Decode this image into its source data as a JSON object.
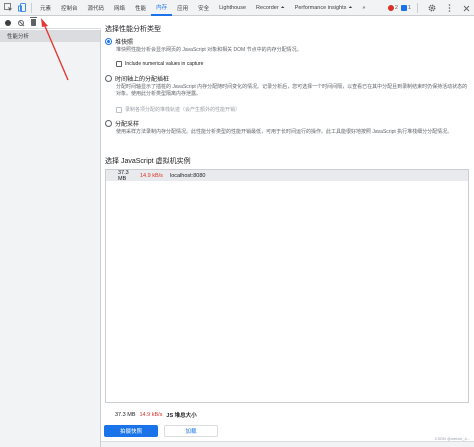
{
  "tabbar": {
    "tabs": [
      {
        "label": "元素"
      },
      {
        "label": "控制台"
      },
      {
        "label": "源代码"
      },
      {
        "label": "网络"
      },
      {
        "label": "性能"
      },
      {
        "label": "内存",
        "active": true
      },
      {
        "label": "应用"
      },
      {
        "label": "安全"
      },
      {
        "label": "Lighthouse"
      },
      {
        "label": "Recorder",
        "suffix": "⏶"
      },
      {
        "label": "Performance insights",
        "suffix": "⏶"
      }
    ],
    "error_count": "2",
    "info_count": "1",
    "more_glyph": "»"
  },
  "sidebar": {
    "items": [
      {
        "label": "性能分析"
      }
    ]
  },
  "main": {
    "profile_type_title": "选择性能分析类型",
    "options": [
      {
        "label": "堆快照",
        "desc": "堆快照性能分析会显示网页的 JavaScript 对象和相关 DOM 节点中的内存分配情况。",
        "checkbox": "Include numerical values in capture",
        "selected": true
      },
      {
        "label": "时间轴上的分配插桩",
        "desc": "分配时间轴显示了插桩的 JavaScript 内存分配随时间变化的情况。记录分析后，您可选择一个时间间隔，以查看已在其中分配且到录制结束时仍保持活动状态的对象。使用此分析类型隔离内存泄露。",
        "checkbox": "录制各项分配的堆栈轨迹（会产生额外的性能开销）",
        "selected": false
      },
      {
        "label": "分配采样",
        "desc": "使用采样方法录制内存分配情况。此性能分析类型的性能开销最低，可用于长时间运行的操作。此工具能很好地按照 JavaScript 执行堆栈细分分配情况。",
        "selected": false
      }
    ],
    "vm_title": "选择 JavaScript 虚拟机实例",
    "vm_instances": [
      {
        "size": "37.3 MB",
        "rate": "14.9 kB/s",
        "target": "localhost:8080"
      }
    ],
    "total": {
      "size": "37.3 MB",
      "rate": "14.9 kB/s",
      "label": "JS 堆总大小"
    },
    "take_snapshot_label": "拍摄快照",
    "load_label": "加载"
  },
  "watermark": "CSDN @weixin_4...",
  "colors": {
    "accent": "#1a73e8",
    "error": "#d93025",
    "annotation": "#e53935"
  }
}
